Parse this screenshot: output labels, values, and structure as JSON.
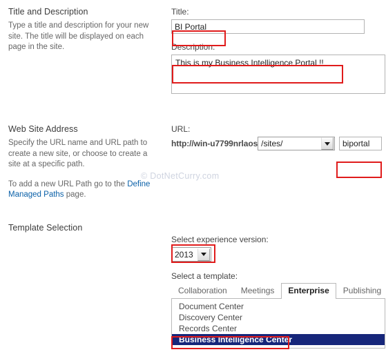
{
  "watermark": "© DotNetCurry.com",
  "sections": {
    "title_description": {
      "heading": "Title and Description",
      "help": "Type a title and description for your new site. The title will be displayed on each page in the site.",
      "title_label": "Title:",
      "title_value": "BI Portal",
      "description_label": "Description:",
      "description_value": "This is my Business Intelligence Portal !!"
    },
    "web_site_address": {
      "heading": "Web Site Address",
      "help_1": "Specify the URL name and URL path to create a new site, or choose to create a site at a specific path.",
      "help_2_prefix": "To add a new URL Path go to the ",
      "help_2_link": "Define Managed Paths",
      "help_2_suffix": " page.",
      "url_label": "URL:",
      "host": "http://win-u7799nrlaos",
      "path_selected": "/sites/",
      "url_name_value": "biportal"
    },
    "template_selection": {
      "heading": "Template Selection",
      "experience_label": "Select experience version:",
      "experience_value": "2013",
      "template_label": "Select a template:",
      "tabs": [
        {
          "label": "Collaboration",
          "active": false
        },
        {
          "label": "Meetings",
          "active": false
        },
        {
          "label": "Enterprise",
          "active": true
        },
        {
          "label": "Publishing",
          "active": false
        }
      ],
      "templates": [
        {
          "label": "Document Center",
          "selected": false
        },
        {
          "label": "Discovery Center",
          "selected": false
        },
        {
          "label": "Records Center",
          "selected": false
        },
        {
          "label": "Business Intelligence Center",
          "selected": true
        }
      ]
    }
  },
  "colors": {
    "annotation": "#e01b1b",
    "selection": "#16267a",
    "link": "#0a60a8"
  }
}
